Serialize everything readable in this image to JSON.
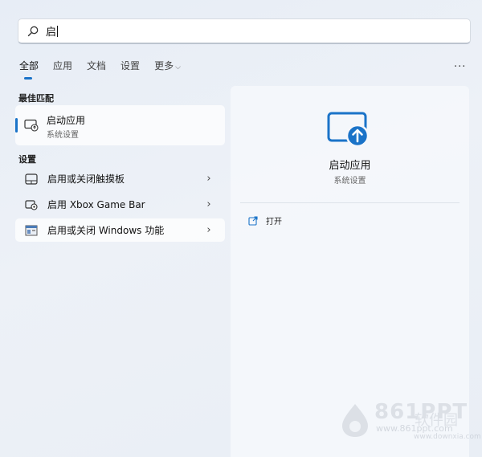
{
  "search": {
    "query": "启"
  },
  "filters": {
    "items": [
      "全部",
      "应用",
      "文档",
      "设置",
      "更多"
    ],
    "active": "全部",
    "more_menu": "..."
  },
  "best_match": {
    "section_title": "最佳匹配",
    "name": "启动应用",
    "subtitle": "系统设置",
    "icon": "startup-apps-icon"
  },
  "settings": {
    "section_title": "设置",
    "items": [
      {
        "label": "启用或关闭触摸板",
        "icon": "touchpad-icon"
      },
      {
        "label": "启用 Xbox Game Bar",
        "icon": "game-bar-icon"
      },
      {
        "label": "启用或关闭 Windows 功能",
        "icon": "windows-features-icon"
      }
    ]
  },
  "detail": {
    "title": "启动应用",
    "subtitle": "系统设置",
    "action_open": "打开"
  },
  "watermark": {
    "brand": "861PPT",
    "name": "软件园",
    "url1": "www.861ppt.com",
    "url2": "www.downxia.com"
  },
  "colors": {
    "accent": "#1a73c8"
  }
}
